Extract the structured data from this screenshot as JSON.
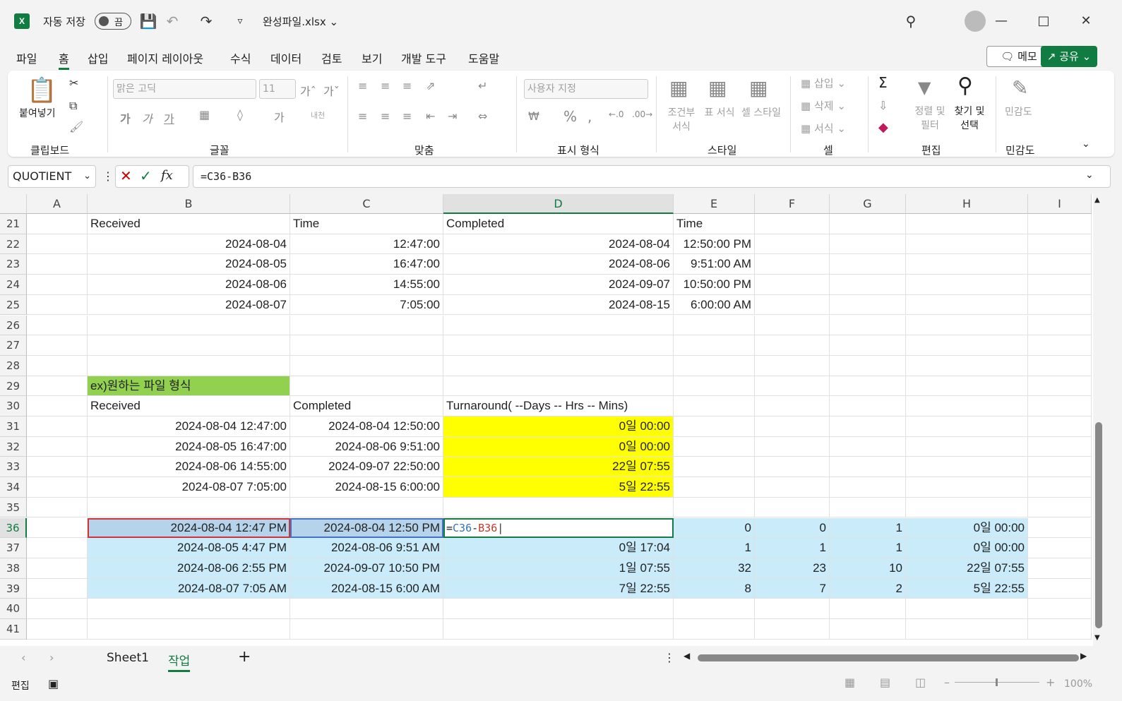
{
  "titlebar": {
    "autosave_label": "자동 저장",
    "autosave_state": "끔",
    "filename": "완성파일.xlsx",
    "app_icon": "X"
  },
  "menu": {
    "tabs": [
      "파일",
      "홈",
      "삽입",
      "페이지 레이아웃",
      "수식",
      "데이터",
      "검토",
      "보기",
      "개발 도구",
      "도움말"
    ],
    "active": "홈",
    "memo_label": "메모",
    "share_label": "공유"
  },
  "ribbon": {
    "clipboard": {
      "paste_label": "붙여넣기",
      "group": "클립보드"
    },
    "font": {
      "font_name": "맑은 고딕",
      "font_size": "11",
      "bold": "가",
      "italic": "가",
      "underline": "가",
      "wrap": "내천",
      "group": "글꼴"
    },
    "align": {
      "group": "맞춤"
    },
    "number": {
      "format": "사용자 지정",
      "group": "표시 형식"
    },
    "styles": {
      "conditional": "조건부 서식",
      "table": "표 서식",
      "cell": "셀 스타일",
      "group": "스타일"
    },
    "cells": {
      "insert": "삽입",
      "delete": "삭제",
      "format": "서식",
      "group": "셀"
    },
    "editing": {
      "sort": "정렬 및 필터",
      "find": "찾기 및 선택",
      "group": "편집"
    },
    "sensitivity": {
      "label": "민감도",
      "group": "민감도"
    }
  },
  "formula_bar": {
    "name_box": "QUOTIENT",
    "formula": "=C36-B36"
  },
  "columns": [
    "A",
    "B",
    "C",
    "D",
    "E",
    "F",
    "G",
    "H",
    "I"
  ],
  "rows": [
    "21",
    "22",
    "23",
    "24",
    "25",
    "26",
    "27",
    "28",
    "29",
    "30",
    "31",
    "32",
    "33",
    "34",
    "35",
    "36",
    "37",
    "38",
    "39",
    "40",
    "41"
  ],
  "cells": {
    "B21": "Received",
    "C21": "Time",
    "D21": "Completed",
    "E21": "Time",
    "B22": "2024-08-04",
    "C22": "12:47:00",
    "D22": "2024-08-04",
    "E22": "12:50:00 PM",
    "B23": "2024-08-05",
    "C23": "16:47:00",
    "D23": "2024-08-06",
    "E23": "9:51:00 AM",
    "B24": "2024-08-06",
    "C24": "14:55:00",
    "D24": "2024-09-07",
    "E24": "10:50:00 PM",
    "B25": "2024-08-07",
    "C25": "7:05:00",
    "D25": "2024-08-15",
    "E25": "6:00:00 AM",
    "B29": "ex)원하는 파일 형식",
    "B30": "Received",
    "C30": "Completed",
    "D30": "Turnaround(   --Days   --   Hrs  --      Mins)",
    "B31": "2024-08-04   12:47:00",
    "C31": "2024-08-04   12:50:00",
    "D31": "0일 00:00",
    "B32": "2024-08-05   16:47:00",
    "C32": "2024-08-06   9:51:00",
    "D32": "0일 00:00",
    "B33": "2024-08-06   14:55:00",
    "C33": "2024-09-07   22:50:00",
    "D33": "22일 07:55",
    "B34": "2024-08-07   7:05:00",
    "C34": "2024-08-15   6:00:00",
    "D34": "5일 22:55",
    "B36": "2024-08-04 12:47 PM",
    "C36": "2024-08-04 12:50 PM",
    "D36_ref1": "C36",
    "D36_ref2": "B36",
    "E36": "0",
    "F36": "0",
    "G36": "1",
    "H36": "0일 00:00",
    "B37": "2024-08-05 4:47 PM",
    "C37": "2024-08-06 9:51 AM",
    "D37": "0일 17:04",
    "E37": "1",
    "F37": "1",
    "G37": "1",
    "H37": "0일 00:00",
    "B38": "2024-08-06 2:55 PM",
    "C38": "2024-09-07 10:50 PM",
    "D38": "1일 07:55",
    "E38": "32",
    "F38": "23",
    "G38": "10",
    "H38": "22일 07:55",
    "B39": "2024-08-07 7:05 AM",
    "C39": "2024-08-15 6:00 AM",
    "D39": "7일 22:55",
    "E39": "8",
    "F39": "7",
    "G39": "2",
    "H39": "5일 22:55"
  },
  "sheets": {
    "tab1": "Sheet1",
    "tab2": "작업",
    "active": "작업"
  },
  "status": {
    "mode": "편집",
    "zoom": "100%"
  },
  "colors": {
    "excel_green": "#107c41",
    "yellow": "#ffff00",
    "light_green": "#92d050",
    "light_blue": "#c9ebfa"
  }
}
